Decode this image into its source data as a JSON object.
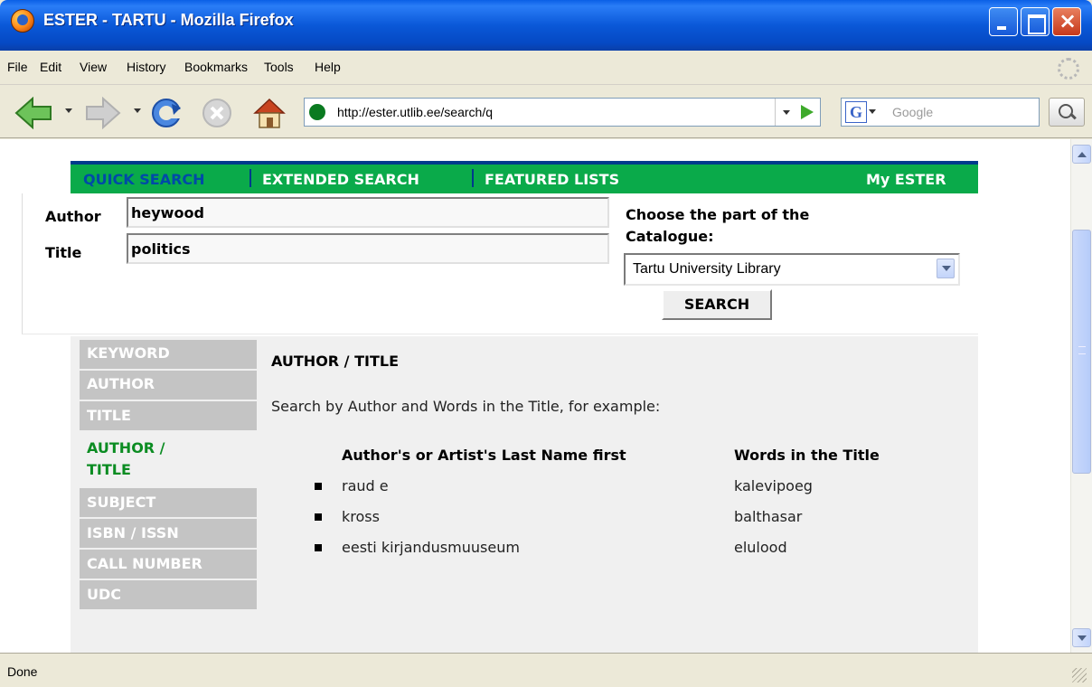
{
  "window": {
    "title": "ESTER - TARTU - Mozilla Firefox"
  },
  "menu": [
    "File",
    "Edit",
    "View",
    "History",
    "Bookmarks",
    "Tools",
    "Help"
  ],
  "address": {
    "url": "http://ester.utlib.ee/search/q"
  },
  "websearch": {
    "placeholder": "Google",
    "engine_letter": "G"
  },
  "site_nav": {
    "quick": "QUICK SEARCH",
    "extended": "EXTENDED SEARCH",
    "featured": "FEATURED LISTS",
    "my": "My ESTER"
  },
  "form": {
    "author_label": "Author",
    "author_value": "heywood",
    "title_label": "Title",
    "title_value": "politics",
    "catalogue_label_1": "Choose the part of the",
    "catalogue_label_2": "Catalogue:",
    "catalogue_value": "Tartu University Library",
    "search_button": "SEARCH"
  },
  "tabs": {
    "keyword": "KEYWORD",
    "author": "AUTHOR",
    "title": "TITLE",
    "author_title_1": "AUTHOR /",
    "author_title_2": "TITLE",
    "subject": "SUBJECT",
    "isbn": "ISBN / ISSN",
    "call": "CALL NUMBER",
    "udc": "UDC"
  },
  "help": {
    "heading": "AUTHOR / TITLE",
    "description": "Search by Author and Words in the Title, for example:",
    "col_author": "Author's or Artist's Last Name first",
    "col_title": "Words in the Title",
    "examples": [
      {
        "author": "raud e",
        "title": "kalevipoeg"
      },
      {
        "author": "kross",
        "title": "balthasar"
      },
      {
        "author": "eesti kirjandusmuuseum",
        "title": "elulood"
      }
    ]
  },
  "status": {
    "text": "Done"
  }
}
